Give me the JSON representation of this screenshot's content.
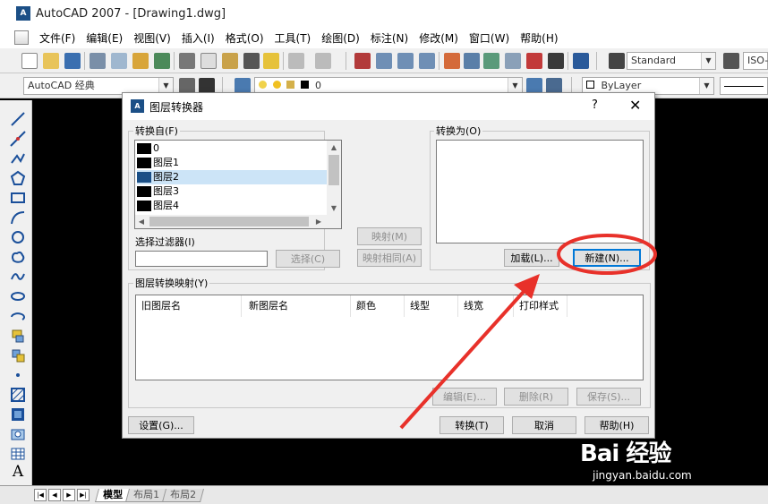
{
  "app": {
    "icon_text": "A",
    "title": "AutoCAD 2007 - [Drawing1.dwg]"
  },
  "menu": [
    "文件(F)",
    "编辑(E)",
    "视图(V)",
    "插入(I)",
    "格式(O)",
    "工具(T)",
    "绘图(D)",
    "标注(N)",
    "修改(M)",
    "窗口(W)",
    "帮助(H)"
  ],
  "toolbar": {
    "text_style": "Standard",
    "dim_style": "ISO-",
    "workspace": "AutoCAD 经典",
    "layer": "0",
    "color": "ByLayer"
  },
  "tabs": [
    "模型",
    "布局1",
    "布局2"
  ],
  "dialog": {
    "title": "图层转换器",
    "help": "?",
    "close": "✕",
    "from_label": "转换自(F)",
    "from_layers": [
      "0",
      "图层1",
      "图层2",
      "图层3",
      "图层4"
    ],
    "to_label": "转换为(O)",
    "filter_label": "选择过滤器(I)",
    "filter_value": "",
    "select_button": "选择(C)",
    "map_button": "映射(M)",
    "map_same_button": "映射相同(A)",
    "load_button": "加载(L)...",
    "new_button": "新建(N)...",
    "mapping_label": "图层转换映射(Y)",
    "columns": [
      "旧图层名",
      "新图层名",
      "颜色",
      "线型",
      "线宽",
      "打印样式"
    ],
    "edit_button": "编辑(E)...",
    "delete_button": "删除(R)",
    "save_button": "保存(S)...",
    "settings_button": "设置(G)...",
    "translate_button": "转换(T)",
    "cancel_button": "取消",
    "helpbtn_button": "帮助(H)"
  },
  "watermark": {
    "logo": "Bai 经验",
    "url": "jingyan.baidu.com"
  },
  "colors": {
    "annotation_red": "#e8312a",
    "focus_blue": "#0078d7",
    "layer_selected": "#1b4f86"
  }
}
